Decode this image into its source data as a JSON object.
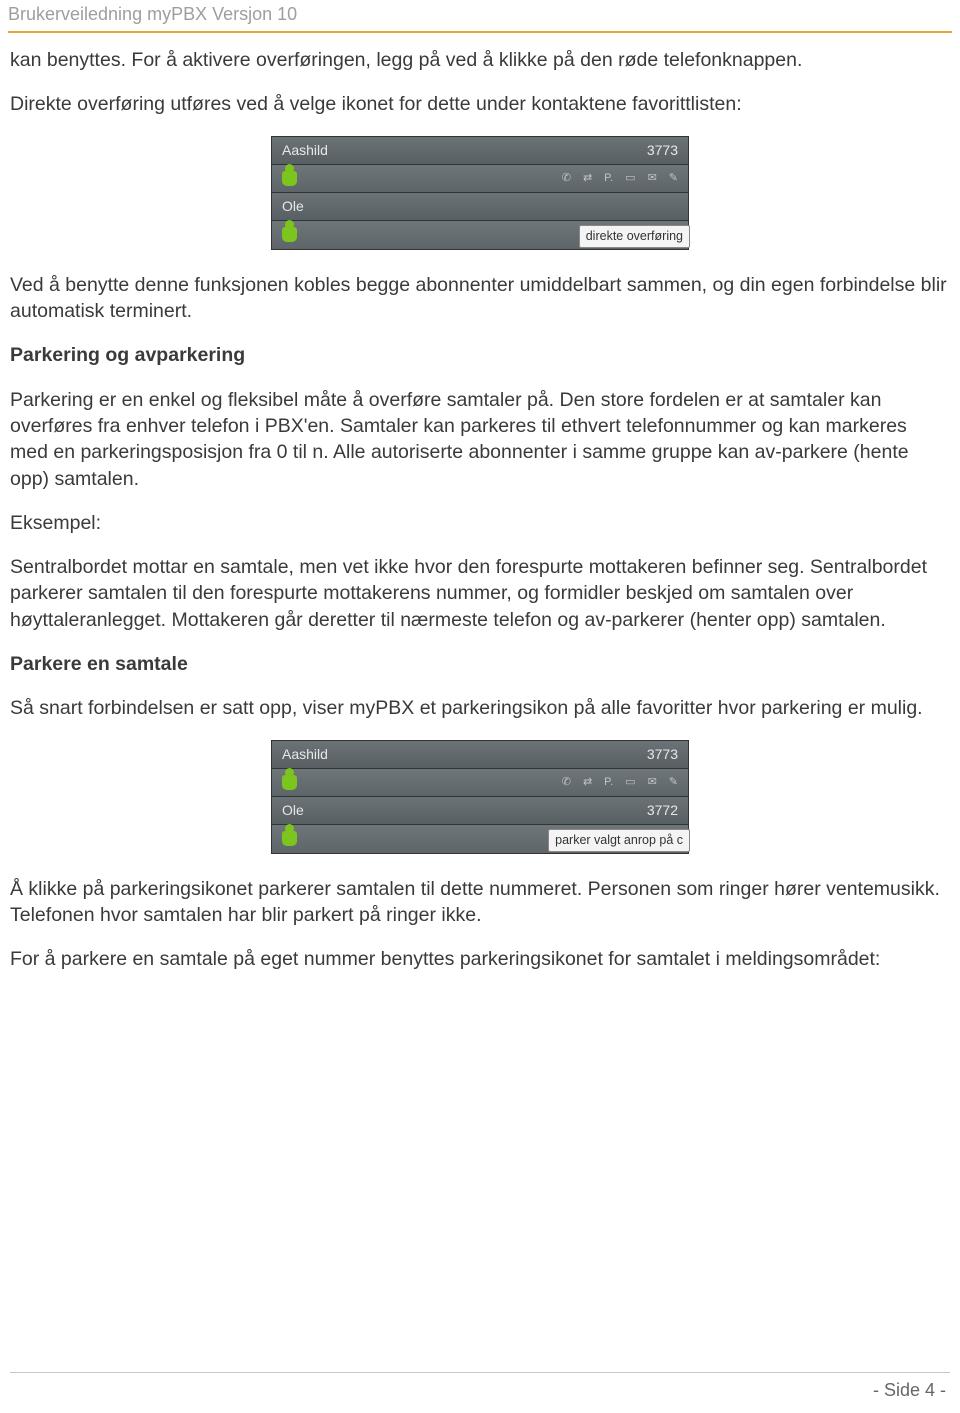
{
  "header": "Brukerveiledning myPBX Versjon 10",
  "p1": " kan benyttes. For å aktivere overføringen, legg på ved å klikke på den røde telefonknappen.",
  "p2": "Direkte overføring utføres ved å velge ikonet for dette under kontaktene favorittlisten:",
  "fig1": {
    "r1_name": "Aashild",
    "r1_num": "3773",
    "r2_name": "Ole",
    "tooltip1": "direkte overføring"
  },
  "p3": "Ved å benytte denne funksjonen kobles begge abonnenter umiddelbart sammen, og din egen forbindelse blir automatisk terminert.",
  "h1": "Parkering og avparkering",
  "p4": "Parkering er en enkel og fleksibel måte å overføre samtaler på. Den store fordelen er at samtaler kan overføres fra enhver telefon i PBX'en. Samtaler kan parkeres til ethvert telefonnummer og kan markeres med en parkeringsposisjon fra 0 til n. Alle autoriserte abonnenter i samme gruppe kan av-parkere (hente opp) samtalen.",
  "p5": "Eksempel:",
  "p6": "Sentralbordet mottar en samtale, men vet ikke hvor den forespurte mottakeren befinner seg. Sentralbordet parkerer samtalen til den forespurte mottakerens nummer, og formidler beskjed om samtalen over høyttaleranlegget. Mottakeren går deretter til nærmeste telefon og av-parkerer (henter opp) samtalen.",
  "h2": "Parkere en samtale",
  "p7": "Så snart forbindelsen er satt opp, viser myPBX et parkeringsikon på alle favoritter hvor parkering er mulig.",
  "fig2": {
    "r1_name": "Aashild",
    "r1_num": "3773",
    "r2_name": "Ole",
    "r2_num": "3772",
    "tooltip2": "parker valgt anrop på c"
  },
  "p8": "Å klikke på parkeringsikonet parkerer samtalen til dette nummeret. Personen som ringer hører ventemusikk. Telefonen hvor samtalen har blir parkert på ringer ikke.",
  "p9": "For å parkere en samtale på eget nummer benyttes parkeringsikonet for samtalet i meldingsområdet:",
  "footer": "- Side 4 -"
}
